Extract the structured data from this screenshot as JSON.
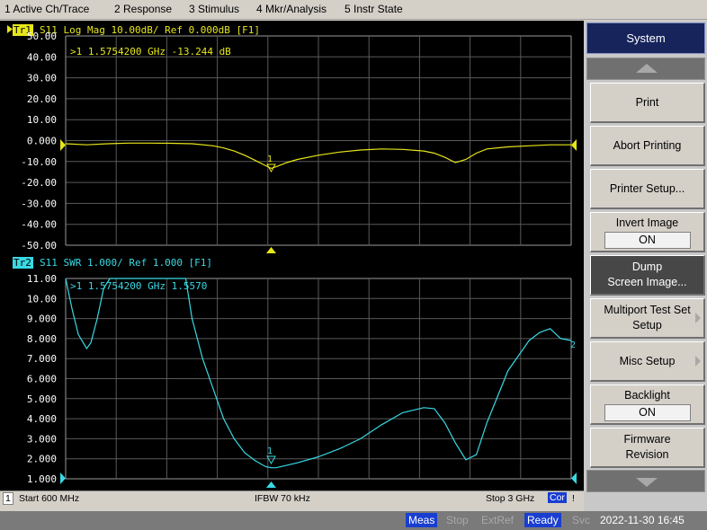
{
  "menu": [
    "1 Active Ch/Trace",
    "2 Response",
    "3 Stimulus",
    "4 Mkr/Analysis",
    "5 Instr State"
  ],
  "trace1": {
    "tag": "Tr1",
    "label": "S11  Log Mag 10.00dB/ Ref 0.000dB [F1]",
    "marker_readout": ">1  1.5754200 GHz -13.244 dB",
    "y_ticks": [
      "50.00",
      "40.00",
      "30.00",
      "20.00",
      "10.00",
      "0.000",
      "-10.00",
      "-20.00",
      "-30.00",
      "-40.00",
      "-50.00"
    ],
    "color": "#e6e619"
  },
  "trace2": {
    "tag": "Tr2",
    "label": "S11  SWR 1.000/ Ref 1.000 [F1]",
    "marker_readout": ">1  1.5754200 GHz  1.5570",
    "y_ticks": [
      "11.00",
      "10.00",
      "9.000",
      "8.000",
      "7.000",
      "6.000",
      "5.000",
      "4.000",
      "3.000",
      "2.000",
      "1.000"
    ],
    "color": "#38d9e4"
  },
  "marker": {
    "label": "1",
    "frequency_ghz": 1.57542
  },
  "end_label_trace2": "2",
  "status": {
    "channel": "1",
    "start": "Start 600 MHz",
    "ifbw": "IFBW 70 kHz",
    "stop": "Stop 3 GHz",
    "cor": "Cor",
    "excl": "!"
  },
  "softkeys": {
    "title": "System",
    "print": "Print",
    "abort_printing": "Abort Printing",
    "printer_setup": "Printer Setup...",
    "invert_image": "Invert Image",
    "invert_image_value": "ON",
    "dump_screen_1": "Dump",
    "dump_screen_2": "Screen Image...",
    "multiport_1": "Multiport Test Set",
    "multiport_2": "Setup",
    "misc_setup": "Misc Setup",
    "backlight": "Backlight",
    "backlight_value": "ON",
    "firmware_1": "Firmware",
    "firmware_2": "Revision"
  },
  "bottom": {
    "meas": "Meas",
    "stop": "Stop",
    "extref": "ExtRef",
    "ready": "Ready",
    "svc": "Svc",
    "datetime": "2022-11-30 16:45"
  },
  "chart_data": {
    "type": "line",
    "x_unit": "GHz",
    "x_range": [
      0.6,
      3.0
    ],
    "series": [
      {
        "name": "Tr1",
        "ylim": [
          -50,
          50
        ],
        "x": [
          0.6,
          0.7,
          0.8,
          0.9,
          1.0,
          1.1,
          1.2,
          1.3,
          1.35,
          1.4,
          1.45,
          1.5,
          1.55,
          1.5754,
          1.6,
          1.65,
          1.7,
          1.8,
          1.9,
          2.0,
          2.1,
          2.2,
          2.3,
          2.35,
          2.4,
          2.45,
          2.5,
          2.55,
          2.6,
          2.7,
          2.8,
          2.9,
          3.0
        ],
        "y": [
          -1.5,
          -2,
          -1.5,
          -1.2,
          -1.2,
          -1.3,
          -1.5,
          -2.5,
          -3.5,
          -5,
          -7,
          -9.5,
          -12,
          -13.244,
          -12.5,
          -10.5,
          -9,
          -7,
          -5.5,
          -4.5,
          -4,
          -4.2,
          -5,
          -6,
          -8,
          -10.5,
          -9,
          -6,
          -4,
          -3,
          -2.5,
          -2,
          -2
        ]
      },
      {
        "name": "Tr2",
        "ylim": [
          1,
          11
        ],
        "x": [
          0.6,
          0.63,
          0.66,
          0.7,
          0.72,
          0.75,
          0.78,
          0.81,
          1.17,
          1.2,
          1.25,
          1.3,
          1.35,
          1.4,
          1.45,
          1.5,
          1.55,
          1.5754,
          1.6,
          1.7,
          1.8,
          1.9,
          2.0,
          2.1,
          2.2,
          2.3,
          2.35,
          2.4,
          2.45,
          2.5,
          2.55,
          2.6,
          2.7,
          2.8,
          2.85,
          2.9,
          2.95,
          3.0
        ],
        "y": [
          11,
          9.5,
          8.2,
          7.5,
          7.8,
          9,
          10.5,
          11,
          11,
          9,
          7,
          5.5,
          4,
          3,
          2.3,
          1.9,
          1.6,
          1.557,
          1.55,
          1.8,
          2.1,
          2.5,
          3,
          3.7,
          4.3,
          4.55,
          4.5,
          3.8,
          2.8,
          1.95,
          2.2,
          3.8,
          6.4,
          7.9,
          8.3,
          8.5,
          8,
          7.9
        ]
      }
    ]
  }
}
